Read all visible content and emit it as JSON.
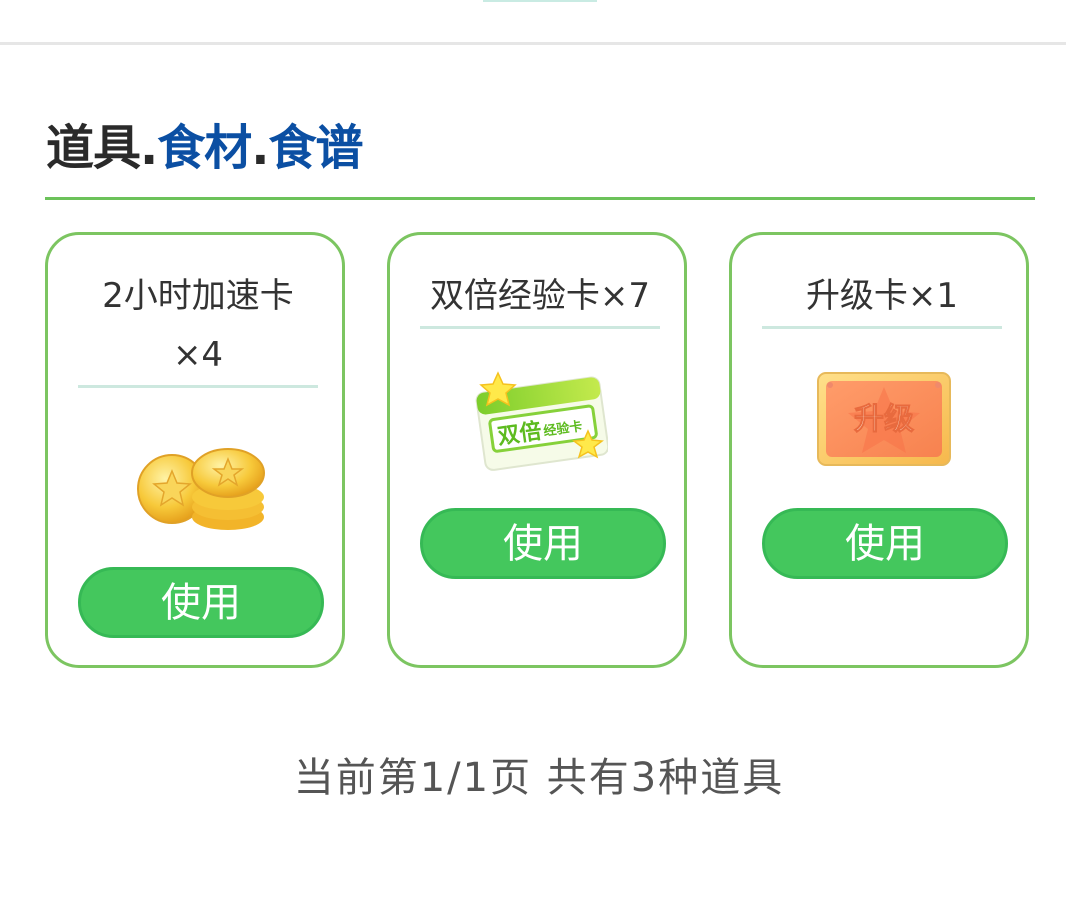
{
  "nav": {
    "tabs": [
      {
        "label": "道具"
      },
      {
        "label": "食材"
      },
      {
        "label": "食谱"
      }
    ],
    "separator": "."
  },
  "items": [
    {
      "name": "2小时加速卡",
      "count": "×4",
      "icon": "gold-coins-icon",
      "button": "使用"
    },
    {
      "name": "双倍经验卡×7",
      "icon": "double-exp-card-icon",
      "icon_text_big": "双倍",
      "icon_text_small": "经验卡",
      "button": "使用"
    },
    {
      "name": "升级卡×1",
      "icon": "upgrade-card-icon",
      "icon_text": "升级",
      "button": "使用"
    }
  ],
  "pager": {
    "text": "当前第1/1页 共有3种道具"
  },
  "colors": {
    "accent_green": "#44c75d",
    "card_border": "#7cc561",
    "link_blue": "#0b4fa3"
  }
}
